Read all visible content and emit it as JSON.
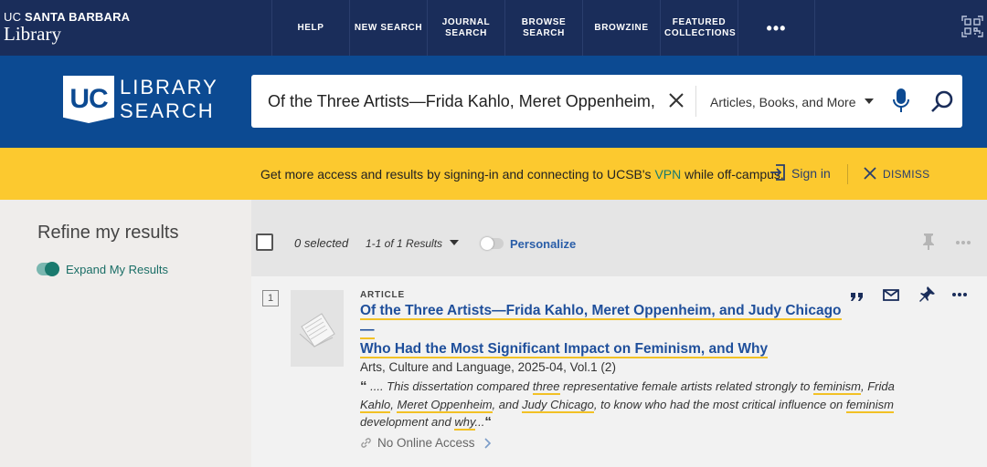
{
  "header": {
    "brand_line1_prefix": "UC",
    "brand_line1_bold": "SANTA BARBARA",
    "brand_line2": "Library",
    "nav": [
      {
        "label": "HELP"
      },
      {
        "label": "NEW SEARCH"
      },
      {
        "label": "JOURNAL SEARCH"
      },
      {
        "label": "BROWSE SEARCH"
      },
      {
        "label": "BROWZINE"
      },
      {
        "label": "FEATURED COLLECTIONS"
      },
      {
        "label": "•••"
      }
    ],
    "qr_icon": "qr-code-icon"
  },
  "search": {
    "logo_mark": "UC",
    "logo_line1": "LIBRARY",
    "logo_line2": "SEARCH",
    "query": "Of the Three Artists—Frida Kahlo, Meret Oppenheim, and Judy Chicago—Who Had the Most Significant Impact on Feminism, and Why",
    "scope": "Articles, Books, and More",
    "icons": [
      "close-icon",
      "chevron-down-icon",
      "microphone-icon",
      "search-icon"
    ]
  },
  "banner": {
    "text_before": "Get more access and results by signing-in and connecting to UCSB's ",
    "vpn": "VPN",
    "text_after": " while off-campus.",
    "signin": "Sign in",
    "dismiss": "DISMISS",
    "vpn_color": "#1a7a6e"
  },
  "sidebar": {
    "title": "Refine my results",
    "expand_label": "Expand My Results",
    "expand_on": true
  },
  "results": {
    "selected": "0 selected",
    "count": "1-1 of 1 Results",
    "personalize": "Personalize",
    "personalize_on": false,
    "records": [
      {
        "number": "1",
        "type": "ARTICLE",
        "title_lines": [
          "Of the Three Artists—Frida Kahlo, Meret Oppenheim, and Judy Chicago—",
          "Who Had the Most Significant Impact on Feminism, and Why"
        ],
        "source": "Arts, Culture and Language, 2025-04, Vol.1 (2)",
        "snippet": {
          "p1": " .... This dissertation compared ",
          "u1": "three",
          "p2": " representative female artists related strongly to ",
          "u2": "feminism",
          "p3": ", Frida ",
          "u3": "Kahlo",
          "p4": ", ",
          "u4": "Meret Oppenheim",
          "p5": ", and ",
          "u5": "Judy Chicago",
          "p6": ", to know who had the most critical influence on ",
          "u6": "feminism",
          "p7": " development and ",
          "u7": "why",
          "p8": "..."
        },
        "access": "No Online Access",
        "actions": [
          "cite-icon",
          "email-icon",
          "pin-icon",
          "more-icon"
        ]
      }
    ]
  },
  "colors": {
    "nav_bg": "#1a2d5a",
    "search_bg": "#0c4a92",
    "banner_bg": "#fcc92f",
    "link_blue": "#1f4f9b",
    "highlight": "#f2c125"
  }
}
